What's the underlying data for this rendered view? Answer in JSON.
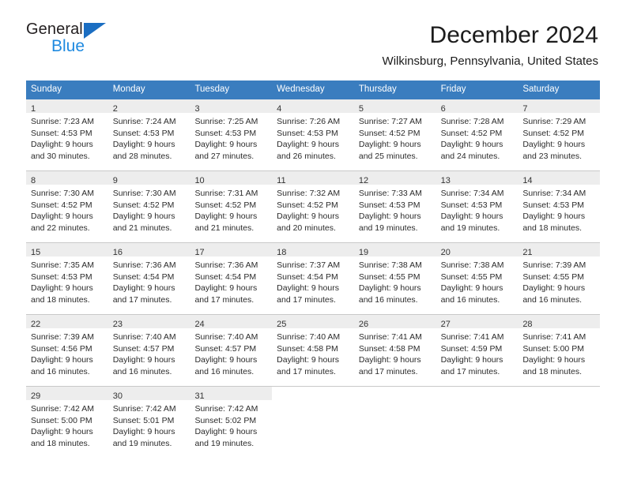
{
  "brand": {
    "name_top": "General",
    "name_bottom": "Blue",
    "triangle_color": "#1b6ec2",
    "blue_text_color": "#1f8ae0"
  },
  "header": {
    "title": "December 2024",
    "subtitle": "Wilkinsburg, Pennsylvania, United States"
  },
  "theme": {
    "header_row_bg": "#3a7dbf",
    "daynum_band_bg": "#ededed",
    "grid_line": "#c9c9c9",
    "text": "#2b2b2b"
  },
  "weekdays": [
    "Sunday",
    "Monday",
    "Tuesday",
    "Wednesday",
    "Thursday",
    "Friday",
    "Saturday"
  ],
  "weeks": [
    [
      {
        "day": "1",
        "sunrise": "Sunrise: 7:23 AM",
        "sunset": "Sunset: 4:53 PM",
        "daylight_line1": "Daylight: 9 hours",
        "daylight_line2": "and 30 minutes."
      },
      {
        "day": "2",
        "sunrise": "Sunrise: 7:24 AM",
        "sunset": "Sunset: 4:53 PM",
        "daylight_line1": "Daylight: 9 hours",
        "daylight_line2": "and 28 minutes."
      },
      {
        "day": "3",
        "sunrise": "Sunrise: 7:25 AM",
        "sunset": "Sunset: 4:53 PM",
        "daylight_line1": "Daylight: 9 hours",
        "daylight_line2": "and 27 minutes."
      },
      {
        "day": "4",
        "sunrise": "Sunrise: 7:26 AM",
        "sunset": "Sunset: 4:53 PM",
        "daylight_line1": "Daylight: 9 hours",
        "daylight_line2": "and 26 minutes."
      },
      {
        "day": "5",
        "sunrise": "Sunrise: 7:27 AM",
        "sunset": "Sunset: 4:52 PM",
        "daylight_line1": "Daylight: 9 hours",
        "daylight_line2": "and 25 minutes."
      },
      {
        "day": "6",
        "sunrise": "Sunrise: 7:28 AM",
        "sunset": "Sunset: 4:52 PM",
        "daylight_line1": "Daylight: 9 hours",
        "daylight_line2": "and 24 minutes."
      },
      {
        "day": "7",
        "sunrise": "Sunrise: 7:29 AM",
        "sunset": "Sunset: 4:52 PM",
        "daylight_line1": "Daylight: 9 hours",
        "daylight_line2": "and 23 minutes."
      }
    ],
    [
      {
        "day": "8",
        "sunrise": "Sunrise: 7:30 AM",
        "sunset": "Sunset: 4:52 PM",
        "daylight_line1": "Daylight: 9 hours",
        "daylight_line2": "and 22 minutes."
      },
      {
        "day": "9",
        "sunrise": "Sunrise: 7:30 AM",
        "sunset": "Sunset: 4:52 PM",
        "daylight_line1": "Daylight: 9 hours",
        "daylight_line2": "and 21 minutes."
      },
      {
        "day": "10",
        "sunrise": "Sunrise: 7:31 AM",
        "sunset": "Sunset: 4:52 PM",
        "daylight_line1": "Daylight: 9 hours",
        "daylight_line2": "and 21 minutes."
      },
      {
        "day": "11",
        "sunrise": "Sunrise: 7:32 AM",
        "sunset": "Sunset: 4:52 PM",
        "daylight_line1": "Daylight: 9 hours",
        "daylight_line2": "and 20 minutes."
      },
      {
        "day": "12",
        "sunrise": "Sunrise: 7:33 AM",
        "sunset": "Sunset: 4:53 PM",
        "daylight_line1": "Daylight: 9 hours",
        "daylight_line2": "and 19 minutes."
      },
      {
        "day": "13",
        "sunrise": "Sunrise: 7:34 AM",
        "sunset": "Sunset: 4:53 PM",
        "daylight_line1": "Daylight: 9 hours",
        "daylight_line2": "and 19 minutes."
      },
      {
        "day": "14",
        "sunrise": "Sunrise: 7:34 AM",
        "sunset": "Sunset: 4:53 PM",
        "daylight_line1": "Daylight: 9 hours",
        "daylight_line2": "and 18 minutes."
      }
    ],
    [
      {
        "day": "15",
        "sunrise": "Sunrise: 7:35 AM",
        "sunset": "Sunset: 4:53 PM",
        "daylight_line1": "Daylight: 9 hours",
        "daylight_line2": "and 18 minutes."
      },
      {
        "day": "16",
        "sunrise": "Sunrise: 7:36 AM",
        "sunset": "Sunset: 4:54 PM",
        "daylight_line1": "Daylight: 9 hours",
        "daylight_line2": "and 17 minutes."
      },
      {
        "day": "17",
        "sunrise": "Sunrise: 7:36 AM",
        "sunset": "Sunset: 4:54 PM",
        "daylight_line1": "Daylight: 9 hours",
        "daylight_line2": "and 17 minutes."
      },
      {
        "day": "18",
        "sunrise": "Sunrise: 7:37 AM",
        "sunset": "Sunset: 4:54 PM",
        "daylight_line1": "Daylight: 9 hours",
        "daylight_line2": "and 17 minutes."
      },
      {
        "day": "19",
        "sunrise": "Sunrise: 7:38 AM",
        "sunset": "Sunset: 4:55 PM",
        "daylight_line1": "Daylight: 9 hours",
        "daylight_line2": "and 16 minutes."
      },
      {
        "day": "20",
        "sunrise": "Sunrise: 7:38 AM",
        "sunset": "Sunset: 4:55 PM",
        "daylight_line1": "Daylight: 9 hours",
        "daylight_line2": "and 16 minutes."
      },
      {
        "day": "21",
        "sunrise": "Sunrise: 7:39 AM",
        "sunset": "Sunset: 4:55 PM",
        "daylight_line1": "Daylight: 9 hours",
        "daylight_line2": "and 16 minutes."
      }
    ],
    [
      {
        "day": "22",
        "sunrise": "Sunrise: 7:39 AM",
        "sunset": "Sunset: 4:56 PM",
        "daylight_line1": "Daylight: 9 hours",
        "daylight_line2": "and 16 minutes."
      },
      {
        "day": "23",
        "sunrise": "Sunrise: 7:40 AM",
        "sunset": "Sunset: 4:57 PM",
        "daylight_line1": "Daylight: 9 hours",
        "daylight_line2": "and 16 minutes."
      },
      {
        "day": "24",
        "sunrise": "Sunrise: 7:40 AM",
        "sunset": "Sunset: 4:57 PM",
        "daylight_line1": "Daylight: 9 hours",
        "daylight_line2": "and 16 minutes."
      },
      {
        "day": "25",
        "sunrise": "Sunrise: 7:40 AM",
        "sunset": "Sunset: 4:58 PM",
        "daylight_line1": "Daylight: 9 hours",
        "daylight_line2": "and 17 minutes."
      },
      {
        "day": "26",
        "sunrise": "Sunrise: 7:41 AM",
        "sunset": "Sunset: 4:58 PM",
        "daylight_line1": "Daylight: 9 hours",
        "daylight_line2": "and 17 minutes."
      },
      {
        "day": "27",
        "sunrise": "Sunrise: 7:41 AM",
        "sunset": "Sunset: 4:59 PM",
        "daylight_line1": "Daylight: 9 hours",
        "daylight_line2": "and 17 minutes."
      },
      {
        "day": "28",
        "sunrise": "Sunrise: 7:41 AM",
        "sunset": "Sunset: 5:00 PM",
        "daylight_line1": "Daylight: 9 hours",
        "daylight_line2": "and 18 minutes."
      }
    ],
    [
      {
        "day": "29",
        "sunrise": "Sunrise: 7:42 AM",
        "sunset": "Sunset: 5:00 PM",
        "daylight_line1": "Daylight: 9 hours",
        "daylight_line2": "and 18 minutes."
      },
      {
        "day": "30",
        "sunrise": "Sunrise: 7:42 AM",
        "sunset": "Sunset: 5:01 PM",
        "daylight_line1": "Daylight: 9 hours",
        "daylight_line2": "and 19 minutes."
      },
      {
        "day": "31",
        "sunrise": "Sunrise: 7:42 AM",
        "sunset": "Sunset: 5:02 PM",
        "daylight_line1": "Daylight: 9 hours",
        "daylight_line2": "and 19 minutes."
      },
      {
        "day": "",
        "sunrise": "",
        "sunset": "",
        "daylight_line1": "",
        "daylight_line2": ""
      },
      {
        "day": "",
        "sunrise": "",
        "sunset": "",
        "daylight_line1": "",
        "daylight_line2": ""
      },
      {
        "day": "",
        "sunrise": "",
        "sunset": "",
        "daylight_line1": "",
        "daylight_line2": ""
      },
      {
        "day": "",
        "sunrise": "",
        "sunset": "",
        "daylight_line1": "",
        "daylight_line2": ""
      }
    ]
  ]
}
